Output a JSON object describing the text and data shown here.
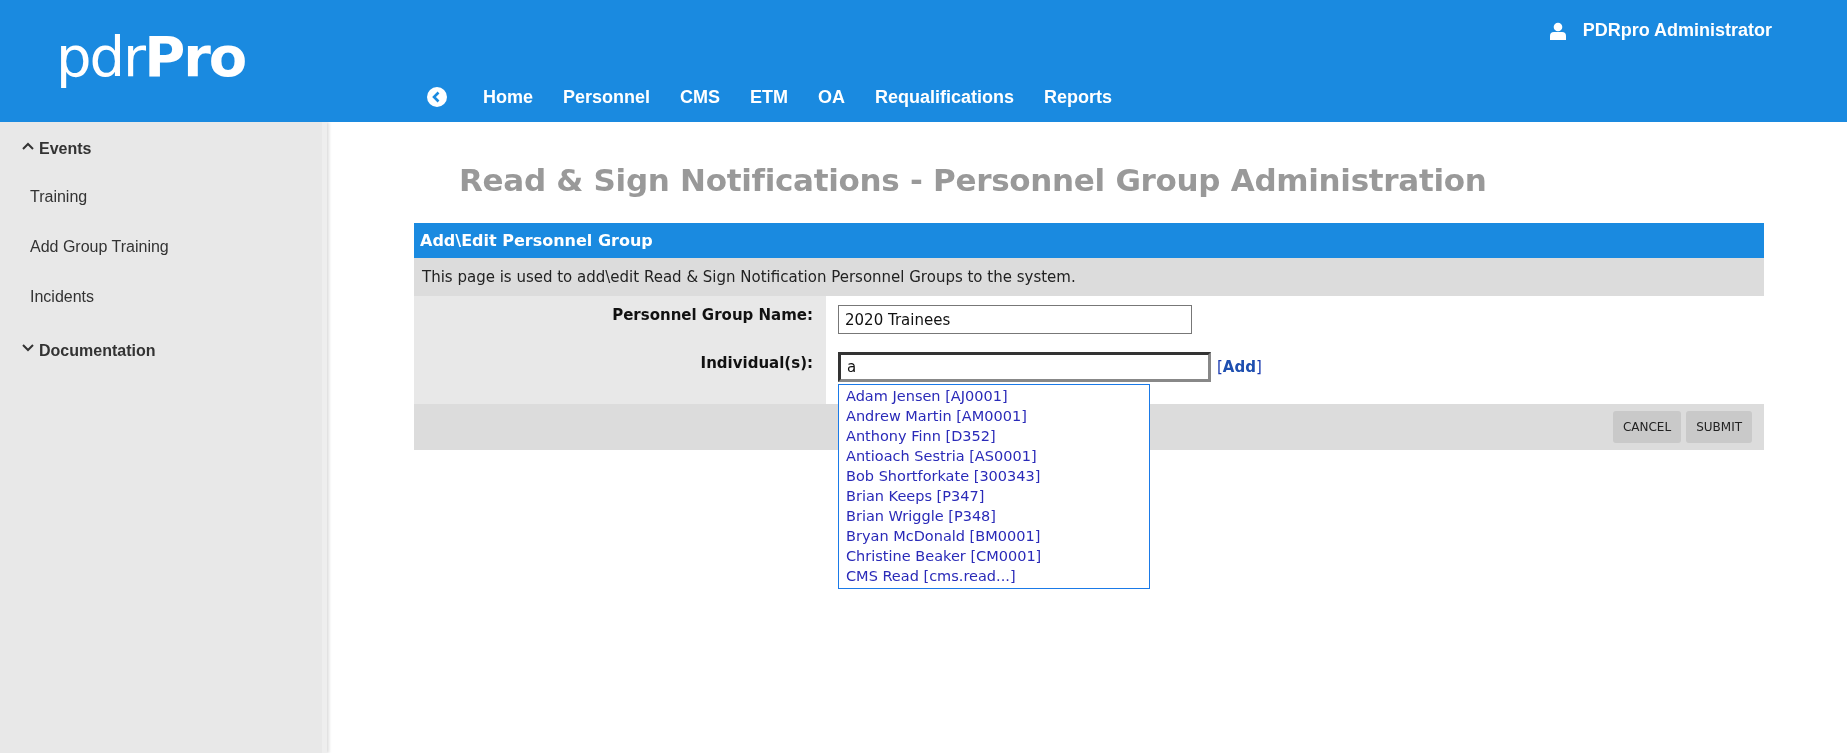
{
  "header": {
    "logo": "pdr**Pro**",
    "user": "PDRpro Administrator",
    "nav": [
      "Home",
      "Personnel",
      "CMS",
      "ETM",
      "OA",
      "Requalifications",
      "Reports"
    ]
  },
  "sidebar": {
    "sections": [
      {
        "label": "Events",
        "expanded": true,
        "items": [
          "Training",
          "Add Group Training",
          "Incidents"
        ]
      },
      {
        "label": "Documentation",
        "expanded": false
      }
    ]
  },
  "page_title": "Read & Sign Notifications - Personnel Group Administration",
  "panel": {
    "title": "Add\\Edit Personnel Group",
    "description": "This page is used to add\\edit Read & Sign Notification Personnel Groups to the system.",
    "fields": [
      {
        "kind": "text",
        "label": "Personnel Group Name:",
        "value": "2020 Trainees"
      },
      {
        "kind": "autocomplete",
        "label": "Individual(s):",
        "value": "a",
        "link": "[**Add**]",
        "suggestions": [
          "Adam Jensen [AJ0001]",
          "Andrew Martin [AM0001]",
          "Anthony Finn [D352]",
          "Antioach Sestria [AS0001]",
          "Bob Shortforkate [300343]",
          "Brian Keeps [P347]",
          "Brian Wriggle [P348]",
          "Bryan McDonald [BM0001]",
          "Christine Beaker [CM0001]",
          "CMS Read [cms.read...]"
        ]
      }
    ],
    "buttons": [
      "CANCEL",
      "SUBMIT"
    ]
  }
}
